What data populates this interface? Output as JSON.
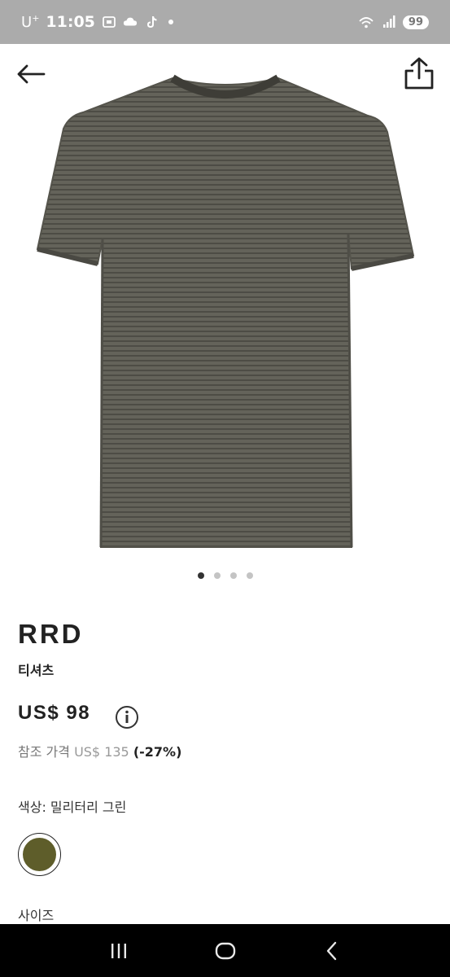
{
  "status_bar": {
    "carrier": "U",
    "carrier_sup": "+",
    "time": "11:05",
    "battery": "99"
  },
  "header": {
    "back_icon": "arrow-left-icon",
    "share_icon": "share-icon"
  },
  "product": {
    "image_icon": "tshirt-image",
    "image_color": "#5f5e55",
    "carousel": {
      "count": 4,
      "active_index": 0
    },
    "brand": "RRD",
    "category": "티셔츠",
    "price": "US$ 98",
    "reference_price": {
      "label": "참조 가격",
      "original": "US$ 135",
      "discount": "(-27%)"
    },
    "color_label": "색상: 밀리터리 그린",
    "color_swatch": "#5e5d2a",
    "size_label": "사이즈"
  },
  "nav": {
    "recent_icon": "recent-apps-icon",
    "home_icon": "home-icon",
    "back_icon": "back-icon"
  }
}
